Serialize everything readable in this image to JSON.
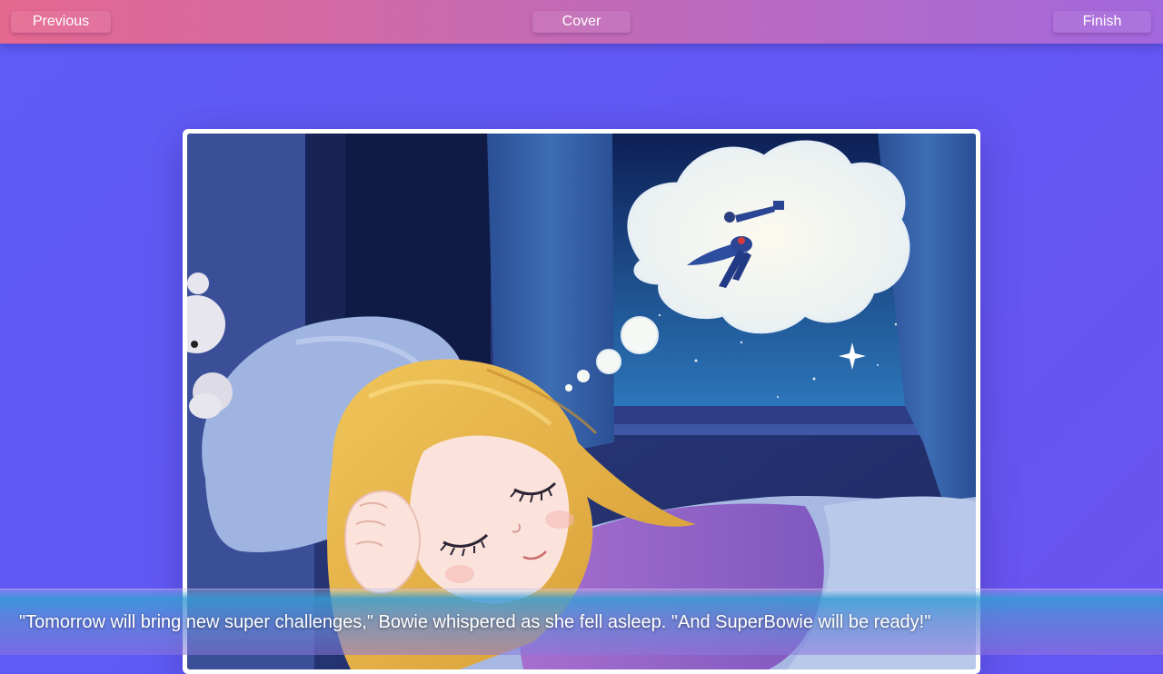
{
  "nav": {
    "previous_label": "Previous",
    "cover_label": "Cover",
    "finish_label": "Finish"
  },
  "page": {
    "caption": "\"Tomorrow will bring new super challenges,\" Bowie whispered as she fell asleep. \"And SuperBowie will be ready!\""
  },
  "illustration": {
    "icon": "sleeping-girl-dreaming-of-superhero-illustration"
  },
  "colors": {
    "topbar_start": "#e5688f",
    "topbar_end": "#a268dd",
    "background": "#5d5cf5"
  }
}
